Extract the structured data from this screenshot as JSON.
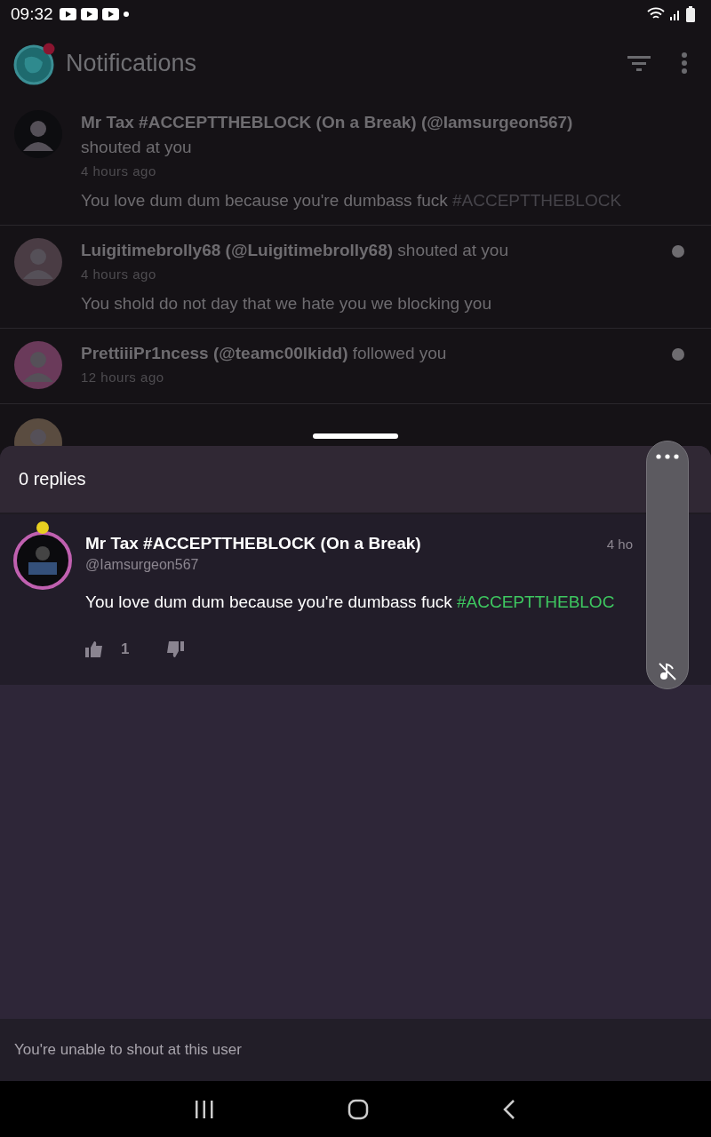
{
  "status_bar": {
    "time": "09:32"
  },
  "header": {
    "title": "Notifications",
    "badge": true
  },
  "notifications": [
    {
      "text": "**Mr Tax #ACCEPTTHEBLOCK (On a Break) (@Iamsurgeon567)** shouted at you",
      "time": "4 hours ago",
      "message": "You love dum dum because you're dumbass fuck",
      "hashtag": "#ACCEPTTHEBLOCK",
      "unread": false
    },
    {
      "text": "**Luigitimebrolly68 (@Luigitimebrolly68)** shouted at you",
      "time": "4 hours ago",
      "message": "You shold do not day that we hate you we blocking you",
      "unread": true
    },
    {
      "text": "**PrettiiiPr1ncess (@teamc00lkidd)** followed you",
      "time": "12 hours ago",
      "unread": true
    },
    {
      "kind": "partial"
    }
  ],
  "sheet": {
    "replies": "0 replies",
    "comment": {
      "author": "Mr Tax #ACCEPTTHEBLOCK (On a Break)",
      "handle": "@Iamsurgeon567",
      "time": "4 ho",
      "message": "You love dum dum because you're dumbass fuck",
      "hashtag": "#ACCEPTTHEBLOC",
      "likes": "1"
    },
    "footer": "You're unable to shout at this user"
  }
}
